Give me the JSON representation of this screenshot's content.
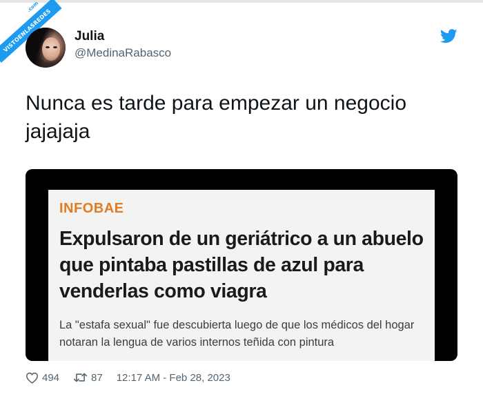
{
  "watermark": {
    "text": "VISTOENLASREDES",
    "suffix": ".com"
  },
  "user": {
    "display_name": "Julia",
    "handle": "@MedinaRabasco",
    "avatar_icon": "profile-photo"
  },
  "brand_icon": "twitter-bird-icon",
  "brand_color": "#1d9bf0",
  "tweet": {
    "text": "Nunca es tarde para empezar un negocio jajajaja"
  },
  "article": {
    "source": "INFOBAE",
    "source_color": "#e07b26",
    "headline": "Expulsaron de un geriátrico a un abuelo que pintaba pastillas de azul para venderlas como viagra",
    "summary": "La \"estafa sexual\" fue descubierta luego de que los médicos del hogar notaran la lengua de varios internos teñida con pintura"
  },
  "stats": {
    "likes_icon": "heart-icon",
    "likes": "494",
    "retweets_icon": "retweet-icon",
    "retweets": "87",
    "timestamp": "12:17 AM - Feb 28, 2023"
  }
}
